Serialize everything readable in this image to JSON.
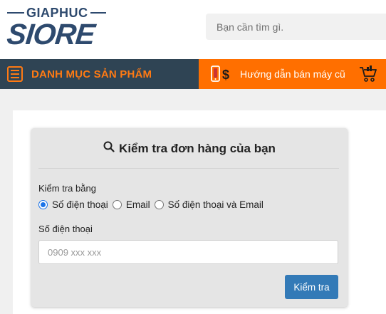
{
  "header": {
    "logo_top": "GIAPHUC",
    "logo_bottom": "SIORE",
    "search_placeholder": "Bạn cần tìm gì."
  },
  "nav": {
    "category_title": "DANH MỤC SẢN PHẨM",
    "guide_label": "Hướng dẫn bán máy cũ"
  },
  "card": {
    "title": "Kiểm tra đơn hàng của bạn",
    "check_by_label": "Kiểm tra bằng",
    "options": [
      {
        "label": "Số điện thoại",
        "checked": true
      },
      {
        "label": "Email",
        "checked": false
      },
      {
        "label": "Số điện thoại và Email",
        "checked": false
      }
    ],
    "phone_label": "Số điện thoại",
    "phone_placeholder": "0909 xxx xxx",
    "submit_label": "Kiểm tra"
  },
  "colors": {
    "brand": "#2e4a6e",
    "nav_dark": "#2f4454",
    "accent_orange": "#ff6f00",
    "button_blue": "#337ab7"
  }
}
